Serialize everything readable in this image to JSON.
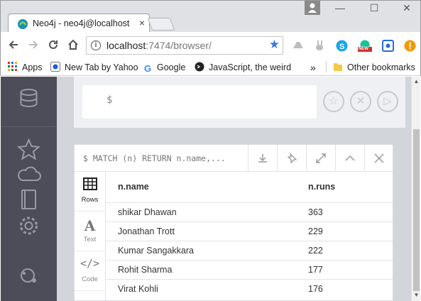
{
  "browser": {
    "tab_title": "Neo4j - neo4j@localhost",
    "tab_close": "×",
    "url_host": "localhost",
    "url_path": ":7474/browser/",
    "window_controls": {
      "minimize": "—",
      "maximize": "☐",
      "close": "✕"
    }
  },
  "bookmarks": [
    {
      "label": "Apps",
      "icon": "apps-grid-icon"
    },
    {
      "label": "New Tab by Yahoo",
      "icon": "yahoo-icon"
    },
    {
      "label": "Google",
      "icon": "google-icon"
    },
    {
      "label": "JavaScript, the weird p",
      "icon": "javascript-icon"
    }
  ],
  "bookmarks_overflow": "»",
  "other_bookmarks": "Other bookmarks",
  "extensions": {
    "new_badge": "NEW"
  },
  "editor": {
    "prompt": "$"
  },
  "result": {
    "query": "$ MATCH (n) RETURN n.name,...",
    "view_tabs": [
      {
        "label": "Rows",
        "active": true
      },
      {
        "label": "Text",
        "active": false
      },
      {
        "label": "Code",
        "active": false
      }
    ],
    "columns": [
      "n.name",
      "n.runs"
    ],
    "rows": [
      {
        "name": "shikar Dhawan",
        "runs": "363"
      },
      {
        "name": "Jonathan Trott",
        "runs": "229"
      },
      {
        "name": "Kumar Sangakkara",
        "runs": "222"
      },
      {
        "name": "Rohit Sharma",
        "runs": "177"
      },
      {
        "name": "Virat Kohli",
        "runs": "176"
      }
    ]
  },
  "colors": {
    "sidebar": "#4d4d5a",
    "content_bg": "#d2d5da",
    "accent_star": "#3b78e7"
  }
}
